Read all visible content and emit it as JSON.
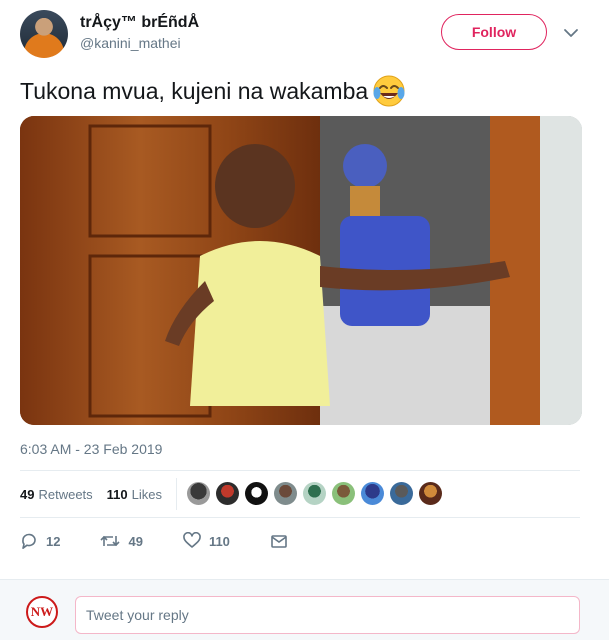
{
  "author": {
    "display_name": "trÅçy™ brÉñdÅ",
    "handle": "@kanini_mathei"
  },
  "header": {
    "follow_label": "Follow",
    "menu_icon": "chevron-down-icon"
  },
  "tweet": {
    "text": "Tukona mvua, kujeni na wakamba",
    "emoji": "face-with-tears-of-joy",
    "timestamp": "6:03 AM - 23 Feb 2019"
  },
  "stats": {
    "retweets_count": "49",
    "retweets_label": "Retweets",
    "likes_count": "110",
    "likes_label": "Likes"
  },
  "actions": {
    "reply_count": "12",
    "retweet_count": "49",
    "like_count": "110"
  },
  "reply": {
    "avatar_text": "NW",
    "placeholder": "Tweet your reply"
  },
  "colors": {
    "accent": "#e0245e",
    "muted": "#657786",
    "divider": "#e6ecf0"
  }
}
